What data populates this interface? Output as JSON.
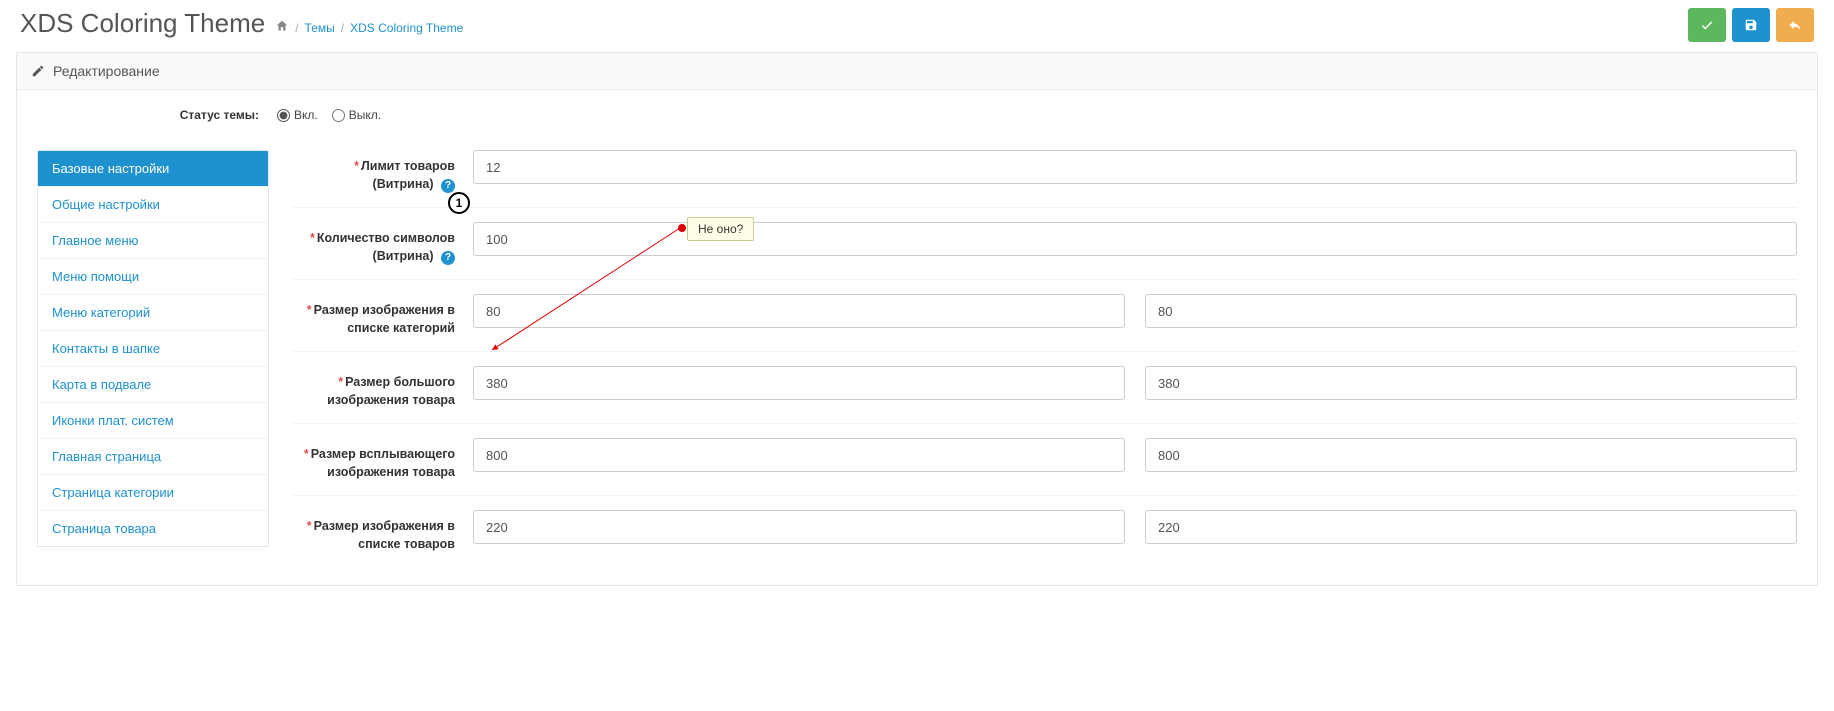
{
  "header": {
    "title": "XDS Coloring Theme",
    "breadcrumb_mid": "Темы",
    "breadcrumb_last": "XDS Coloring Theme"
  },
  "panel": {
    "heading": "Редактирование",
    "status_label": "Статус темы:",
    "radio_on": "Вкл.",
    "radio_off": "Выкл."
  },
  "sidebar": [
    {
      "label": "Базовые настройки",
      "active": true
    },
    {
      "label": "Общие настройки",
      "active": false
    },
    {
      "label": "Главное меню",
      "active": false
    },
    {
      "label": "Меню помощи",
      "active": false
    },
    {
      "label": "Меню категорий",
      "active": false
    },
    {
      "label": "Контакты в шапке",
      "active": false
    },
    {
      "label": "Карта в подвале",
      "active": false
    },
    {
      "label": "Иконки плат. систем",
      "active": false
    },
    {
      "label": "Главная страница",
      "active": false
    },
    {
      "label": "Страница категории",
      "active": false
    },
    {
      "label": "Страница товара",
      "active": false
    }
  ],
  "form": {
    "row1": {
      "label": "Лимит товаров (Витрина)",
      "v1": "12",
      "help": true
    },
    "row2": {
      "label": "Количество символов (Витрина)",
      "v1": "100",
      "help": true
    },
    "row3": {
      "label": "Размер изображения в списке категорий",
      "v1": "80",
      "v2": "80"
    },
    "row4": {
      "label": "Размер большого изображения товара",
      "v1": "380",
      "v2": "380"
    },
    "row5": {
      "label": "Размер всплывающего изображения товара",
      "v1": "800",
      "v2": "800"
    },
    "row6": {
      "label": "Размер изображения в списке товаров",
      "v1": "220",
      "v2": "220"
    }
  },
  "callout": {
    "marker": "1",
    "text": "Не оно?"
  }
}
